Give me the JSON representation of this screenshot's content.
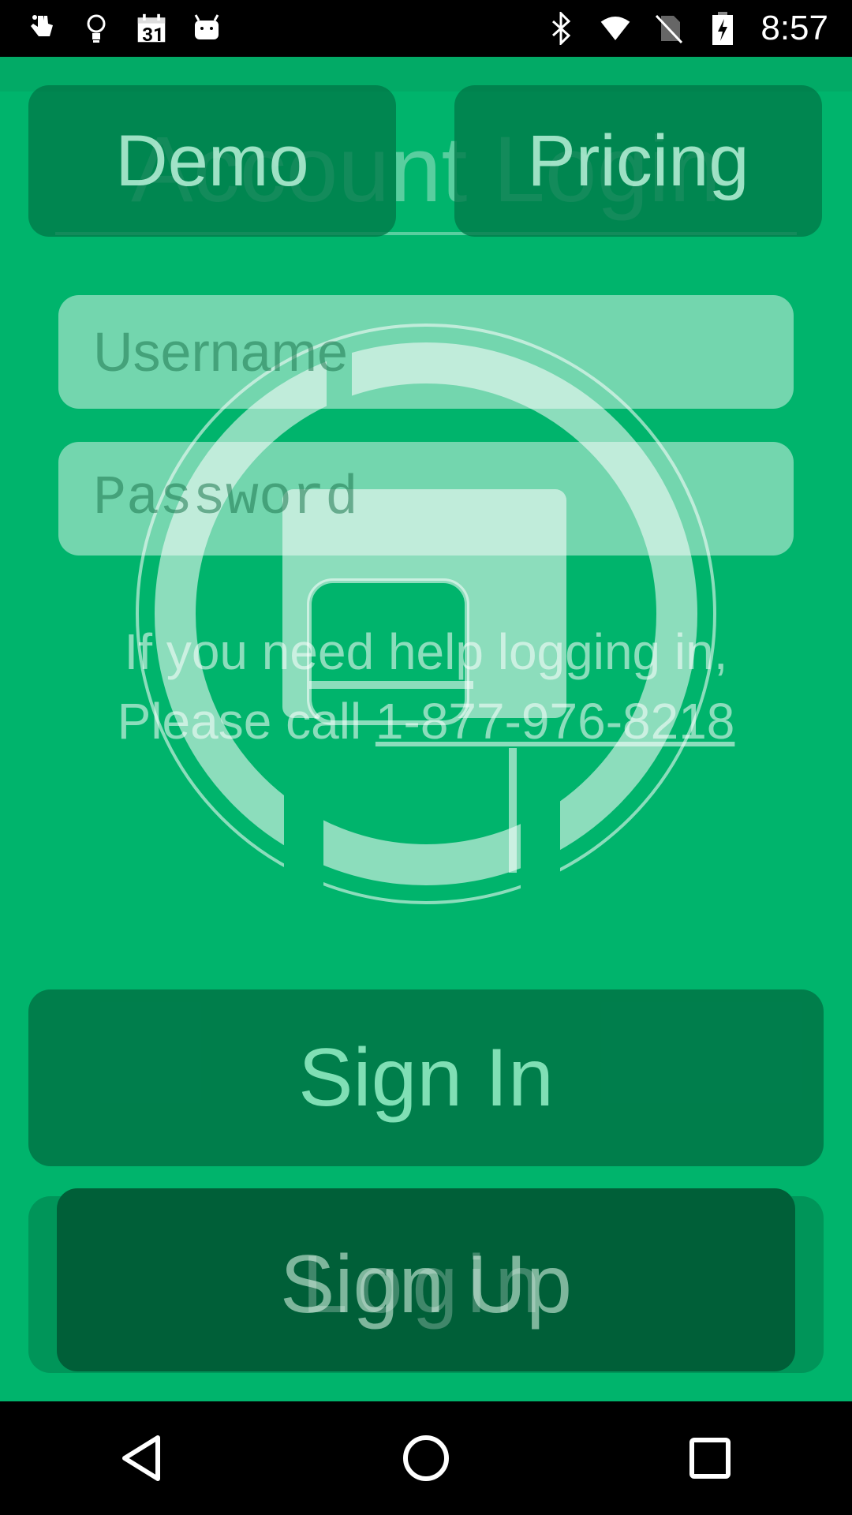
{
  "status_bar": {
    "time": "8:57",
    "calendar_day": "31",
    "icons": [
      "touch-icon",
      "lightbulb-icon",
      "calendar-icon",
      "android-icon",
      "bluetooth-icon",
      "wifi-icon",
      "no-sim-icon",
      "battery-charging-icon"
    ]
  },
  "header": {
    "demo_label": "Demo",
    "pricing_label": "Pricing",
    "title": "Account Login"
  },
  "form": {
    "username_placeholder": "Username",
    "password_placeholder": "Password"
  },
  "help": {
    "line1": "If you need help logging in,",
    "line2_prefix": "Please call ",
    "phone": "1-877-976-8218"
  },
  "actions": {
    "signin_label": "Sign In",
    "signup_label": "Sign Up",
    "login_label": "Login"
  },
  "nav": {
    "icons": [
      "back-icon",
      "home-icon",
      "recents-icon"
    ]
  },
  "colors": {
    "background": "#00b46c",
    "button_dark": "#007848",
    "signup_inner": "#005f38"
  }
}
